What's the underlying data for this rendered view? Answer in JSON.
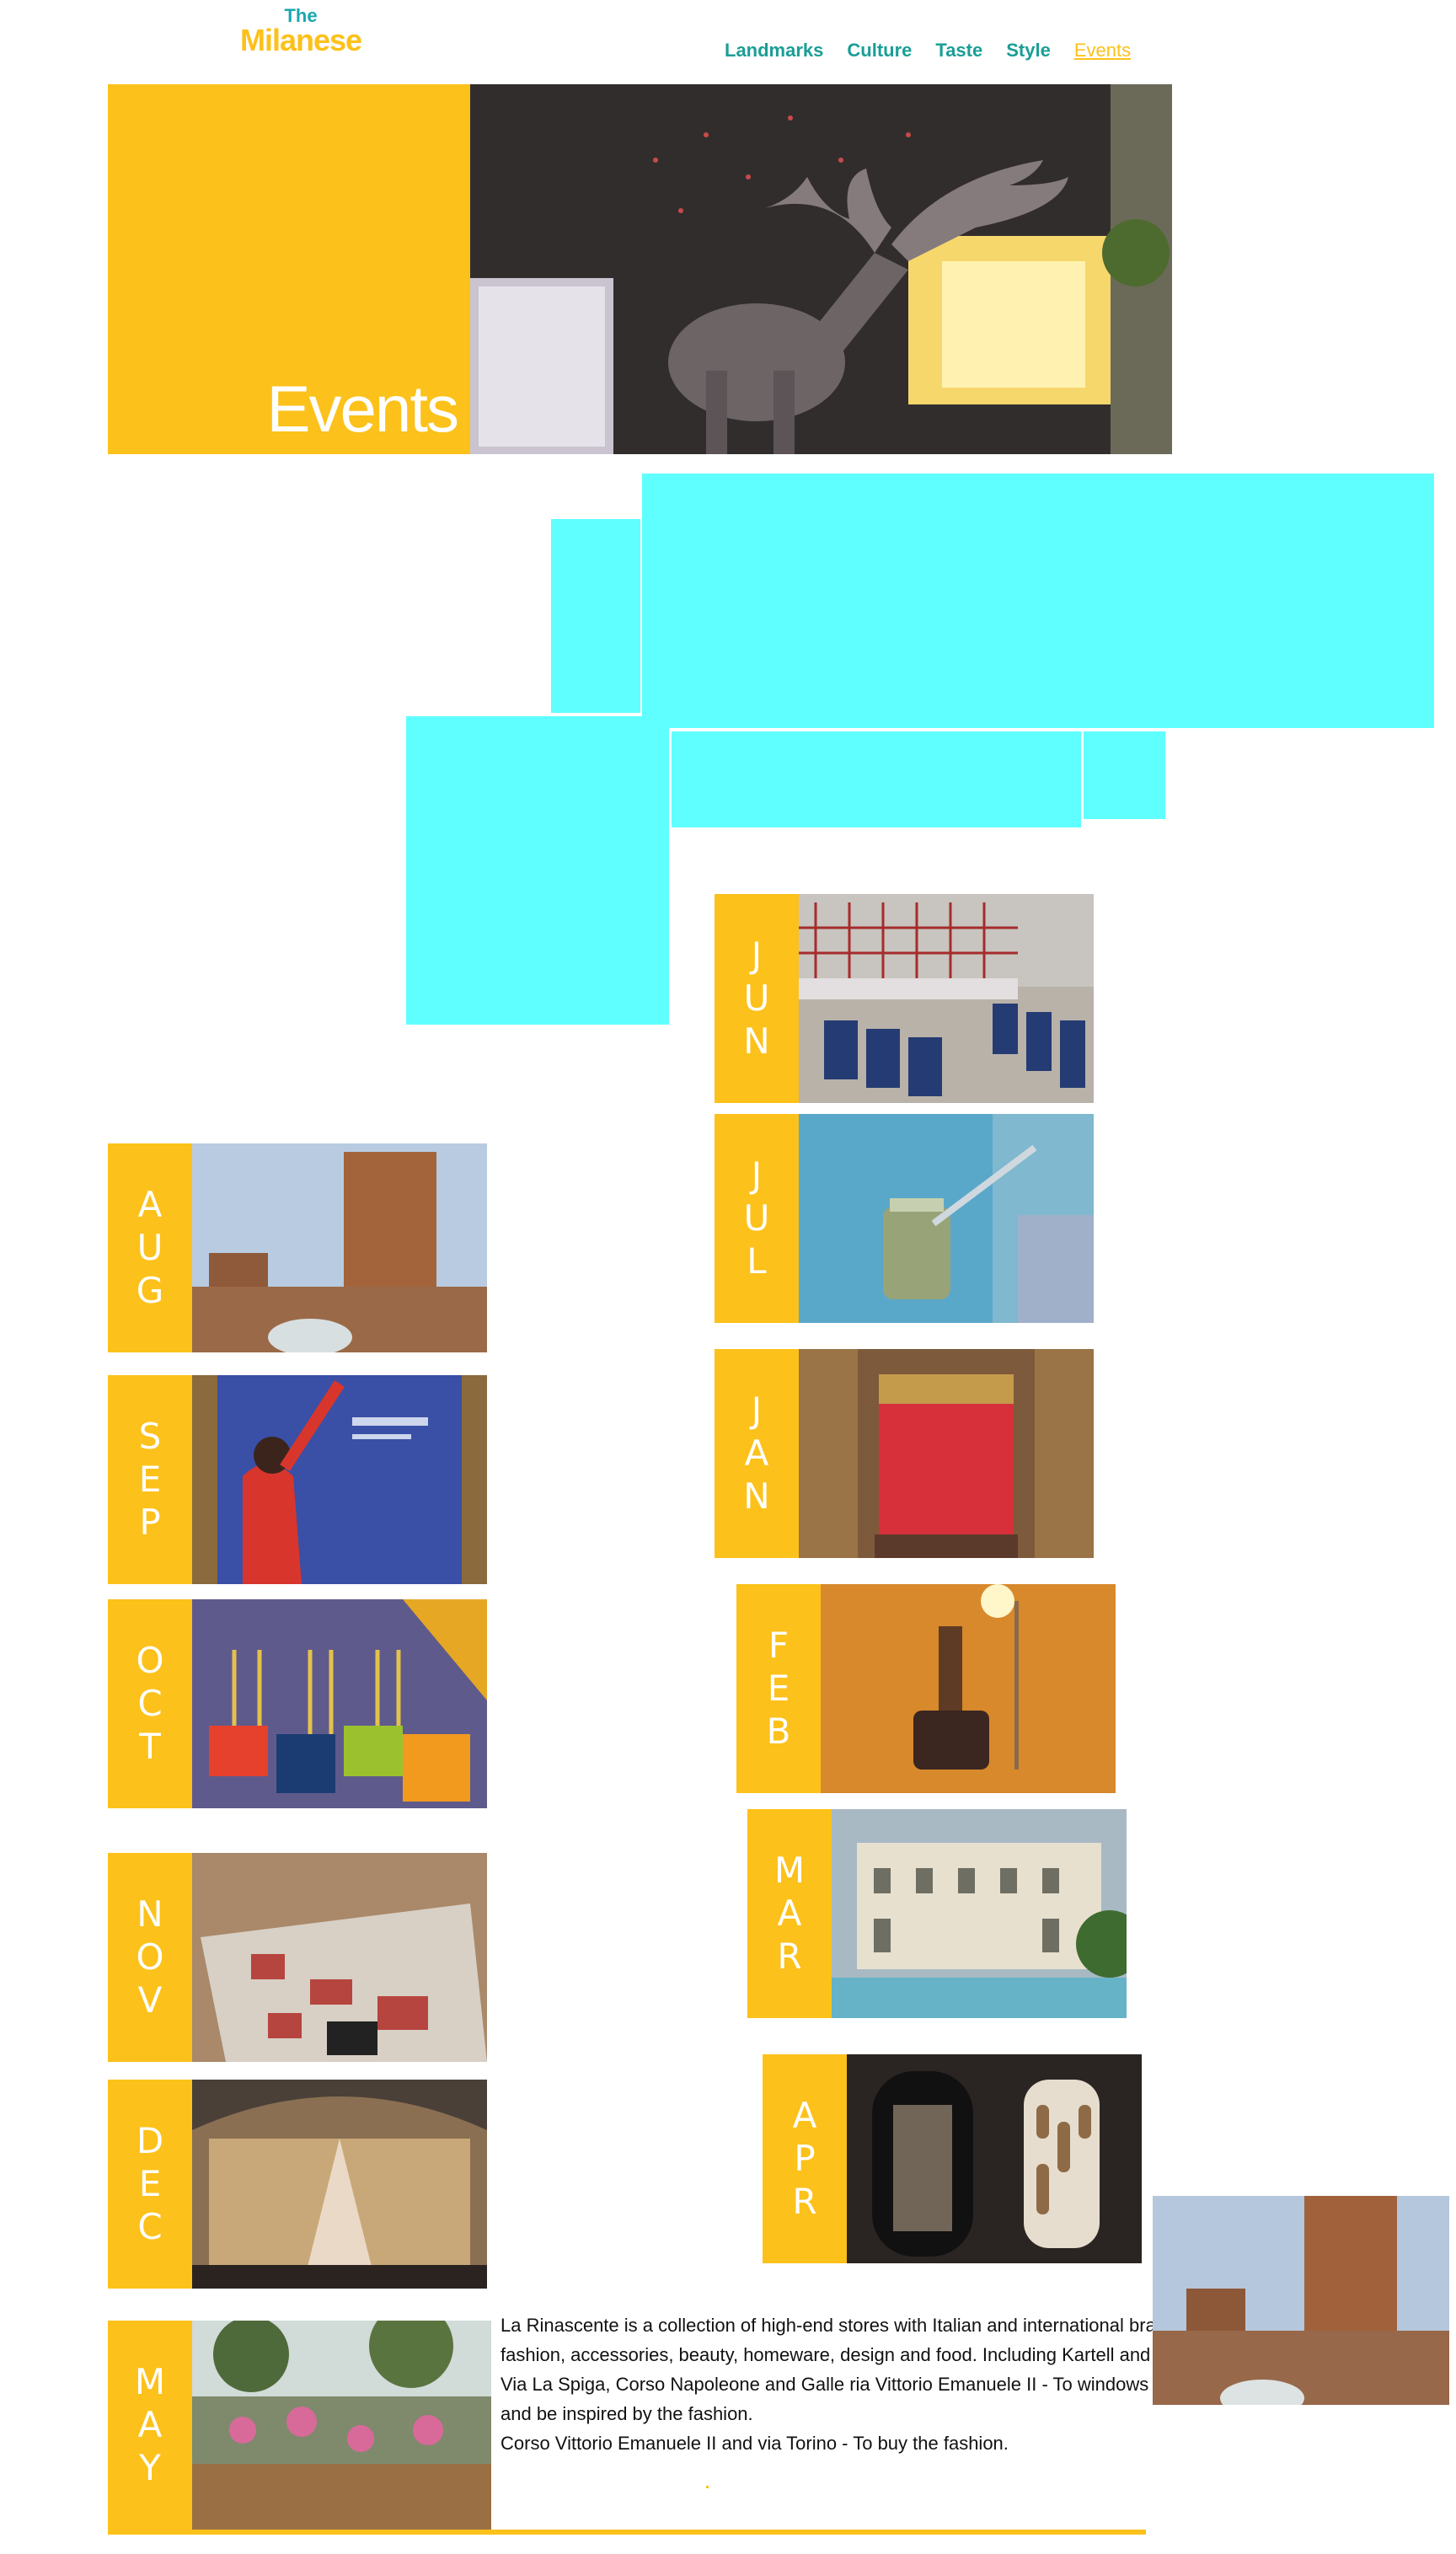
{
  "header": {
    "logo_the": "The",
    "logo_milanese": "Milanese",
    "nav": [
      {
        "label": "Landmarks"
      },
      {
        "label": "Culture"
      },
      {
        "label": "Taste"
      },
      {
        "label": "Style"
      },
      {
        "label": "Events"
      }
    ]
  },
  "hero": {
    "title": "Events"
  },
  "months": {
    "jun": "JUN",
    "jul": "JUL",
    "jan": "JAN",
    "feb": "FEB",
    "mar": "MAR",
    "apr": "APR",
    "aug": "AUG",
    "sep": "SEP",
    "oct": "OCT",
    "nov": "NOV",
    "dec": "DEC",
    "may": "MAY"
  },
  "article": {
    "lines": [
      "La Rinascente is a collection of high-end stores with Italian and international brands",
      "fashion, accessories, beauty, homeware, design and food. Including Kartell and Ales",
      "Via La Spiga, Corso Napoleone and Galle ria Vittorio Emanuele II - To windows watch",
      "and be inspired by the fashion.",
      "Corso Vittorio Emanuele II and via Torino - To buy the fashion."
    ]
  },
  "colors": {
    "accent": "#fcc11a",
    "nav": "#1a9e96",
    "placeholder": "#5fffff"
  }
}
